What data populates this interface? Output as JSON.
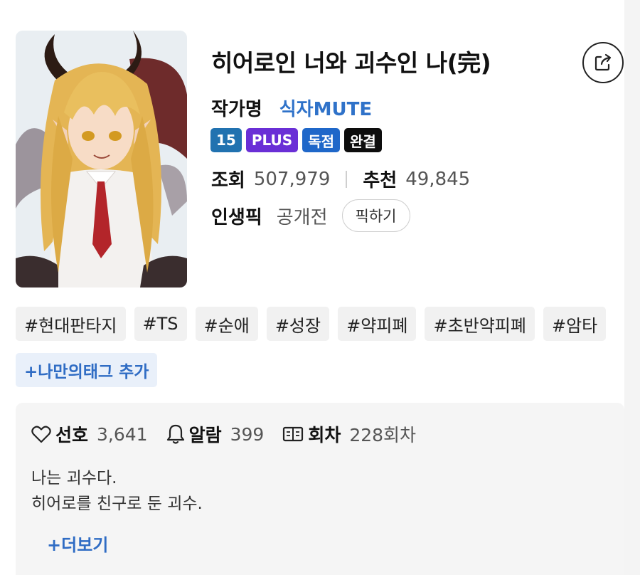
{
  "novel": {
    "title": "히어로인 너와 괴수인 나(完)",
    "author_label": "작가명",
    "author": "식자MUTE",
    "badges": {
      "age": "15",
      "plus": "PLUS",
      "exclusive": "독점",
      "completed": "완결"
    },
    "views_label": "조회",
    "views": "507,979",
    "recommend_label": "추천",
    "recommend": "49,845",
    "pick_label": "인생픽",
    "pick_value": "공개전",
    "pick_button": "픽하기"
  },
  "tags": [
    "#현대판타지",
    "#TS",
    "#순애",
    "#성장",
    "#약피폐",
    "#초반약피폐",
    "#암타"
  ],
  "my_tag_button": "+나만의태그 추가",
  "info": {
    "like_label": "선호",
    "like_count": "3,641",
    "alarm_label": "알람",
    "alarm_count": "399",
    "episode_label": "회차",
    "episode_count": "228회차",
    "description_lines": [
      "나는 괴수다.",
      "히어로를 친구로 둔 괴수."
    ],
    "more_label": "+더보기"
  },
  "icons": {
    "share": "share-icon",
    "like": "heart-icon",
    "alarm": "bell-icon",
    "episode": "book-icon"
  },
  "colors": {
    "author": "#2f72c9",
    "age_badge": "#2172b0",
    "plus_badge": "#6a2fd6",
    "exclusive_badge": "#1f67c9",
    "completed_badge": "#0d0d0d",
    "accent_link": "#2f6cc4"
  }
}
